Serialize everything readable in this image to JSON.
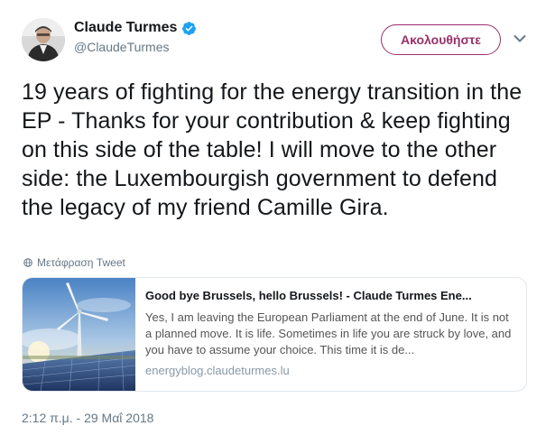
{
  "user": {
    "display_name": "Claude Turmes",
    "handle": "@ClaudeTurmes",
    "verified": true
  },
  "follow_button": {
    "label": "Ακολουθήστε"
  },
  "tweet": {
    "text": "19 years of fighting for the energy transition in the EP - Thanks for your contribution & keep fighting on this side of the table! I will move to the other side: the Luxembourgish government to defend the legacy of my friend Camille Gira.",
    "translate_label": "Μετάφραση Tweet",
    "timestamp": "2:12 π.μ. - 29 Μαΐ 2018"
  },
  "link_card": {
    "title": "Good bye Brussels, hello Brussels! - Claude Turmes Ene...",
    "description": "Yes, I am leaving the European Parliament at the end of June. It is not a planned move. It is life. Sometimes in life you are struck by love, and you have to assume your choice. This time it is de...",
    "domain": "energyblog.claudeturmes.lu"
  },
  "colors": {
    "accent": "#9a2f6b",
    "verified": "#1da1f2",
    "secondary_text": "#657786",
    "border": "#e1e8ed"
  },
  "icons": [
    "verified-badge-icon",
    "caret-down-icon",
    "globe-icon"
  ]
}
